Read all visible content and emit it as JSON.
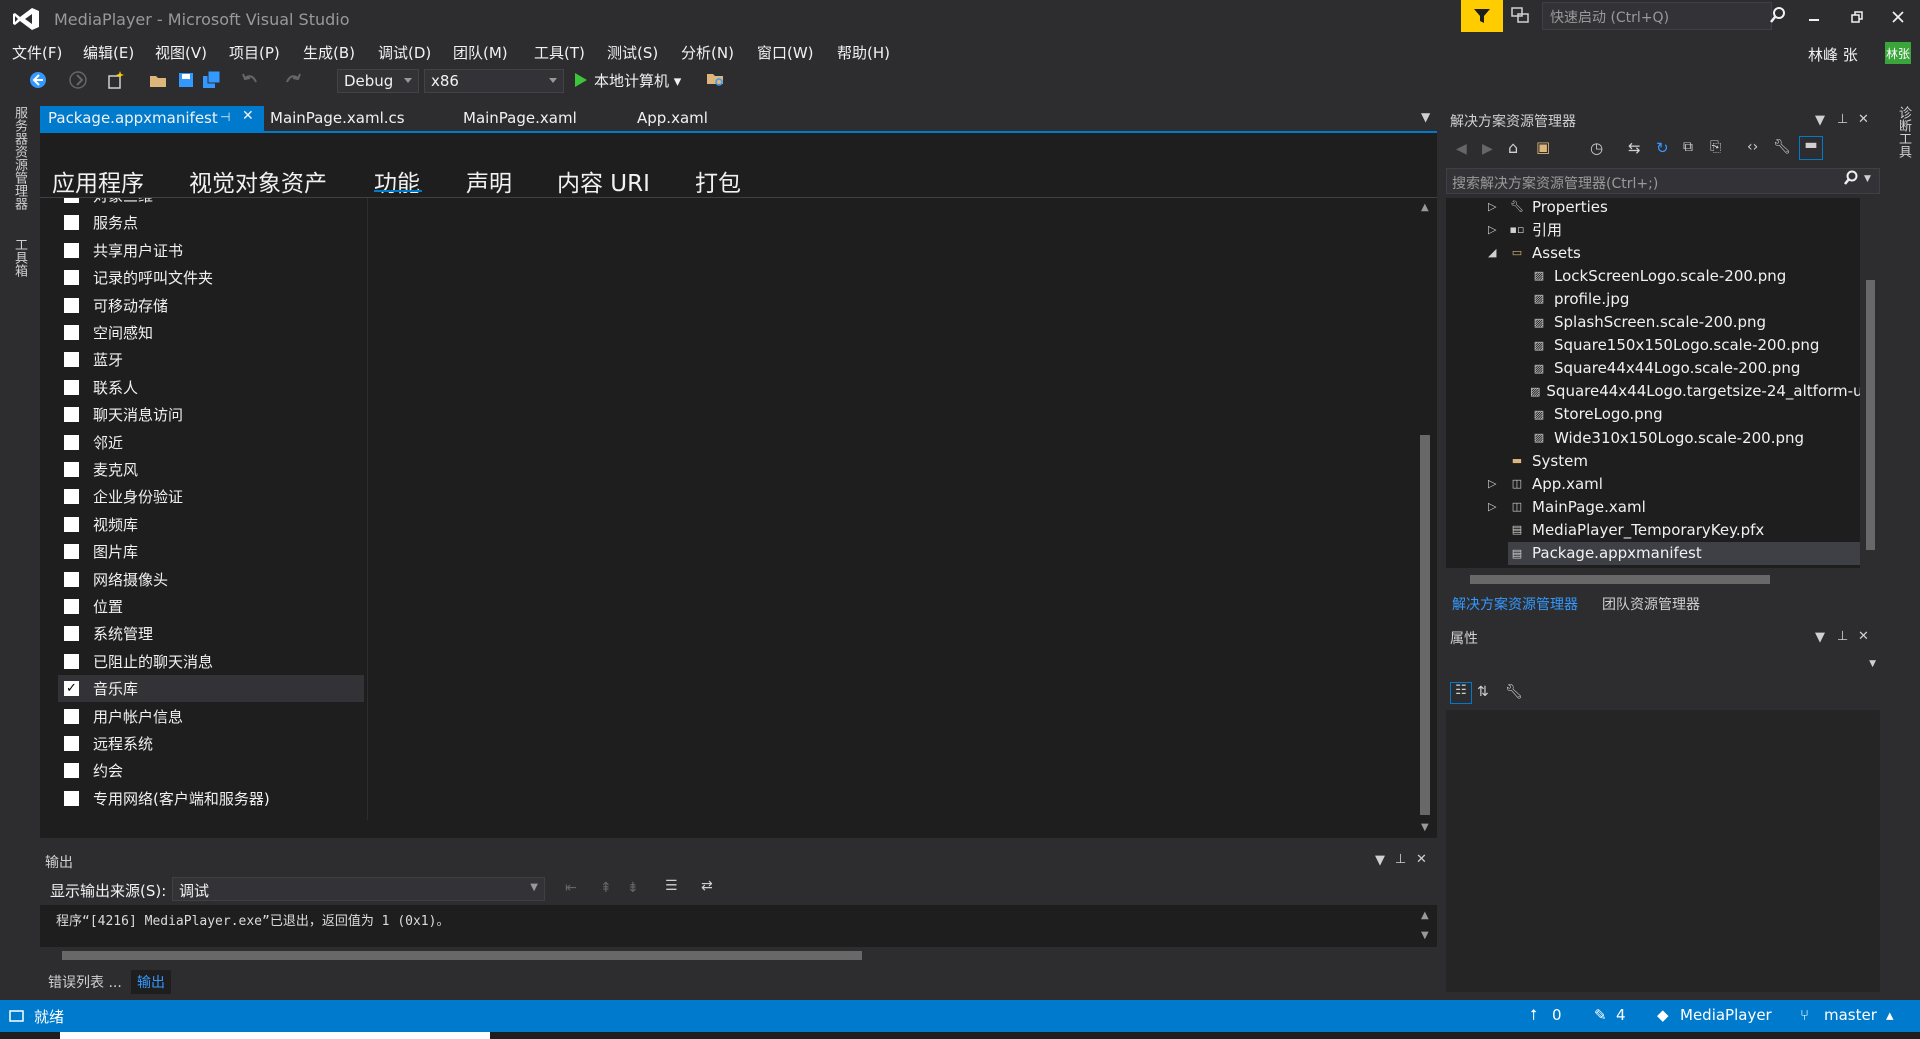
{
  "window": {
    "title": "MediaPlayer - Microsoft Visual Studio",
    "quick_launch_placeholder": "快速启动 (Ctrl+Q)",
    "user_name": "林峰 张",
    "user_avatar": "林张"
  },
  "menu": [
    "文件(F)",
    "编辑(E)",
    "视图(V)",
    "项目(P)",
    "生成(B)",
    "调试(D)",
    "团队(M)",
    "工具(T)",
    "测试(S)",
    "分析(N)",
    "窗口(W)",
    "帮助(H)"
  ],
  "toolbar": {
    "config": "Debug",
    "platform": "x86",
    "run_label": "本地计算机"
  },
  "left_strip": {
    "server_explorer": "服务器资源管理器",
    "toolbox": "工具箱"
  },
  "right_strip": {
    "diagnostics": "诊断工具"
  },
  "doc_tabs": [
    "Package.appxmanifest",
    "MainPage.xaml.cs",
    "MainPage.xaml",
    "App.xaml"
  ],
  "manifest_tabs": [
    "应用程序",
    "视觉对象资产",
    "功能",
    "声明",
    "内容 URI",
    "打包"
  ],
  "active_manifest_tab": "功能",
  "capabilities": [
    {
      "label": "对象三维",
      "checked": false
    },
    {
      "label": "服务点",
      "checked": false
    },
    {
      "label": "共享用户证书",
      "checked": false
    },
    {
      "label": "记录的呼叫文件夹",
      "checked": false
    },
    {
      "label": "可移动存储",
      "checked": false
    },
    {
      "label": "空间感知",
      "checked": false
    },
    {
      "label": "蓝牙",
      "checked": false
    },
    {
      "label": "联系人",
      "checked": false
    },
    {
      "label": "聊天消息访问",
      "checked": false
    },
    {
      "label": "邻近",
      "checked": false
    },
    {
      "label": "麦克风",
      "checked": false
    },
    {
      "label": "企业身份验证",
      "checked": false
    },
    {
      "label": "视频库",
      "checked": false
    },
    {
      "label": "图片库",
      "checked": false
    },
    {
      "label": "网络摄像头",
      "checked": false
    },
    {
      "label": "位置",
      "checked": false
    },
    {
      "label": "系统管理",
      "checked": false
    },
    {
      "label": "已阻止的聊天消息",
      "checked": false
    },
    {
      "label": "音乐库",
      "checked": true
    },
    {
      "label": "用户帐户信息",
      "checked": false
    },
    {
      "label": "远程系统",
      "checked": false
    },
    {
      "label": "约会",
      "checked": false
    },
    {
      "label": "专用网络(客户端和服务器)",
      "checked": false
    }
  ],
  "output": {
    "title": "输出",
    "source_label": "显示输出来源(S):",
    "source_value": "调试",
    "line": "程序“[4216] MediaPlayer.exe”已退出，返回值为 1 (0x1)。"
  },
  "bottom_tabs": [
    "错误列表 ...",
    "输出"
  ],
  "solution_explorer": {
    "title": "解决方案资源管理器",
    "search_placeholder": "搜索解决方案资源管理器(Ctrl+;)",
    "nodes": [
      {
        "label": "Properties",
        "level": 0,
        "expander": "▷",
        "icon": "wrench-icon"
      },
      {
        "label": "引用",
        "level": 0,
        "expander": "▷",
        "icon": "references-icon"
      },
      {
        "label": "Assets",
        "level": 0,
        "expander": "◢",
        "icon": "folder-open-icon"
      },
      {
        "label": "LockScreenLogo.scale-200.png",
        "level": 1,
        "icon": "image-icon"
      },
      {
        "label": "profile.jpg",
        "level": 1,
        "icon": "image-icon"
      },
      {
        "label": "SplashScreen.scale-200.png",
        "level": 1,
        "icon": "image-icon"
      },
      {
        "label": "Square150x150Logo.scale-200.png",
        "level": 1,
        "icon": "image-icon"
      },
      {
        "label": "Square44x44Logo.scale-200.png",
        "level": 1,
        "icon": "image-icon"
      },
      {
        "label": "Square44x44Logo.targetsize-24_altform-u",
        "level": 1,
        "icon": "image-icon"
      },
      {
        "label": "StoreLogo.png",
        "level": 1,
        "icon": "image-icon"
      },
      {
        "label": "Wide310x150Logo.scale-200.png",
        "level": 1,
        "icon": "image-icon"
      },
      {
        "label": "System",
        "level": 0,
        "icon": "folder-icon"
      },
      {
        "label": "App.xaml",
        "level": 0,
        "expander": "▷",
        "icon": "xaml-icon"
      },
      {
        "label": "MainPage.xaml",
        "level": 0,
        "expander": "▷",
        "icon": "xaml-icon"
      },
      {
        "label": "MediaPlayer_TemporaryKey.pfx",
        "level": 0,
        "icon": "certificate-icon"
      },
      {
        "label": "Package.appxmanifest",
        "level": 0,
        "icon": "manifest-icon",
        "selected": true
      }
    ],
    "tabs": [
      "解决方案资源管理器",
      "团队资源管理器"
    ]
  },
  "properties": {
    "title": "属性"
  },
  "status": {
    "text": "就绪",
    "up_count": "0",
    "pending_count": "4",
    "project": "MediaPlayer",
    "branch": "master"
  },
  "colors": {
    "accent": "#007acc",
    "background": "#2d2d30",
    "editor": "#1e1e1e",
    "filter": "#ffcc00"
  }
}
